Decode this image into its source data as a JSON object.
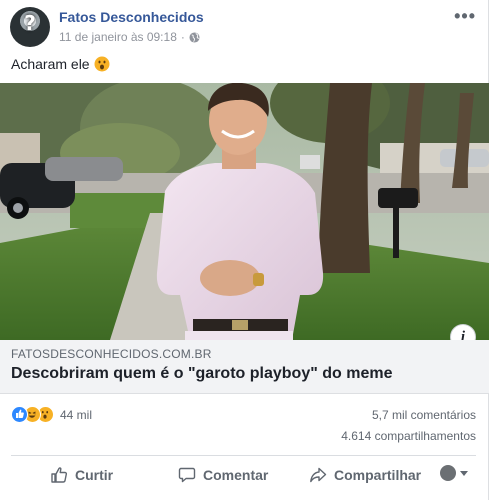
{
  "post": {
    "author": "Fatos Desconhecidos",
    "timestamp": "11 de janeiro às 09:18",
    "separator": "·",
    "audience_icon": "globe-icon",
    "more_icon": "ellipsis-icon",
    "more_glyph": "•••",
    "text": "Acharam ele",
    "text_emoji": "wow-face-emoji"
  },
  "link": {
    "domain": "FATOSDESCONHECIDOS.COM.BR",
    "title": "Descobriram quem é o \"garoto playboy\" do meme",
    "info_glyph": "i"
  },
  "stats": {
    "reaction_icons": [
      "like-icon",
      "haha-icon",
      "wow-icon"
    ],
    "reactions_count": "44 mil",
    "comments": "5,7 mil comentários",
    "shares": "4.614 compartilhamentos"
  },
  "actions": {
    "like": "Curtir",
    "comment": "Comentar",
    "share": "Compartilhar"
  },
  "colors": {
    "author_link": "#365899",
    "secondary_text": "#606770",
    "like_blue": "#2d88ff",
    "reaction_yellow": "#f7b125",
    "link_box_bg": "#f2f3f5"
  }
}
